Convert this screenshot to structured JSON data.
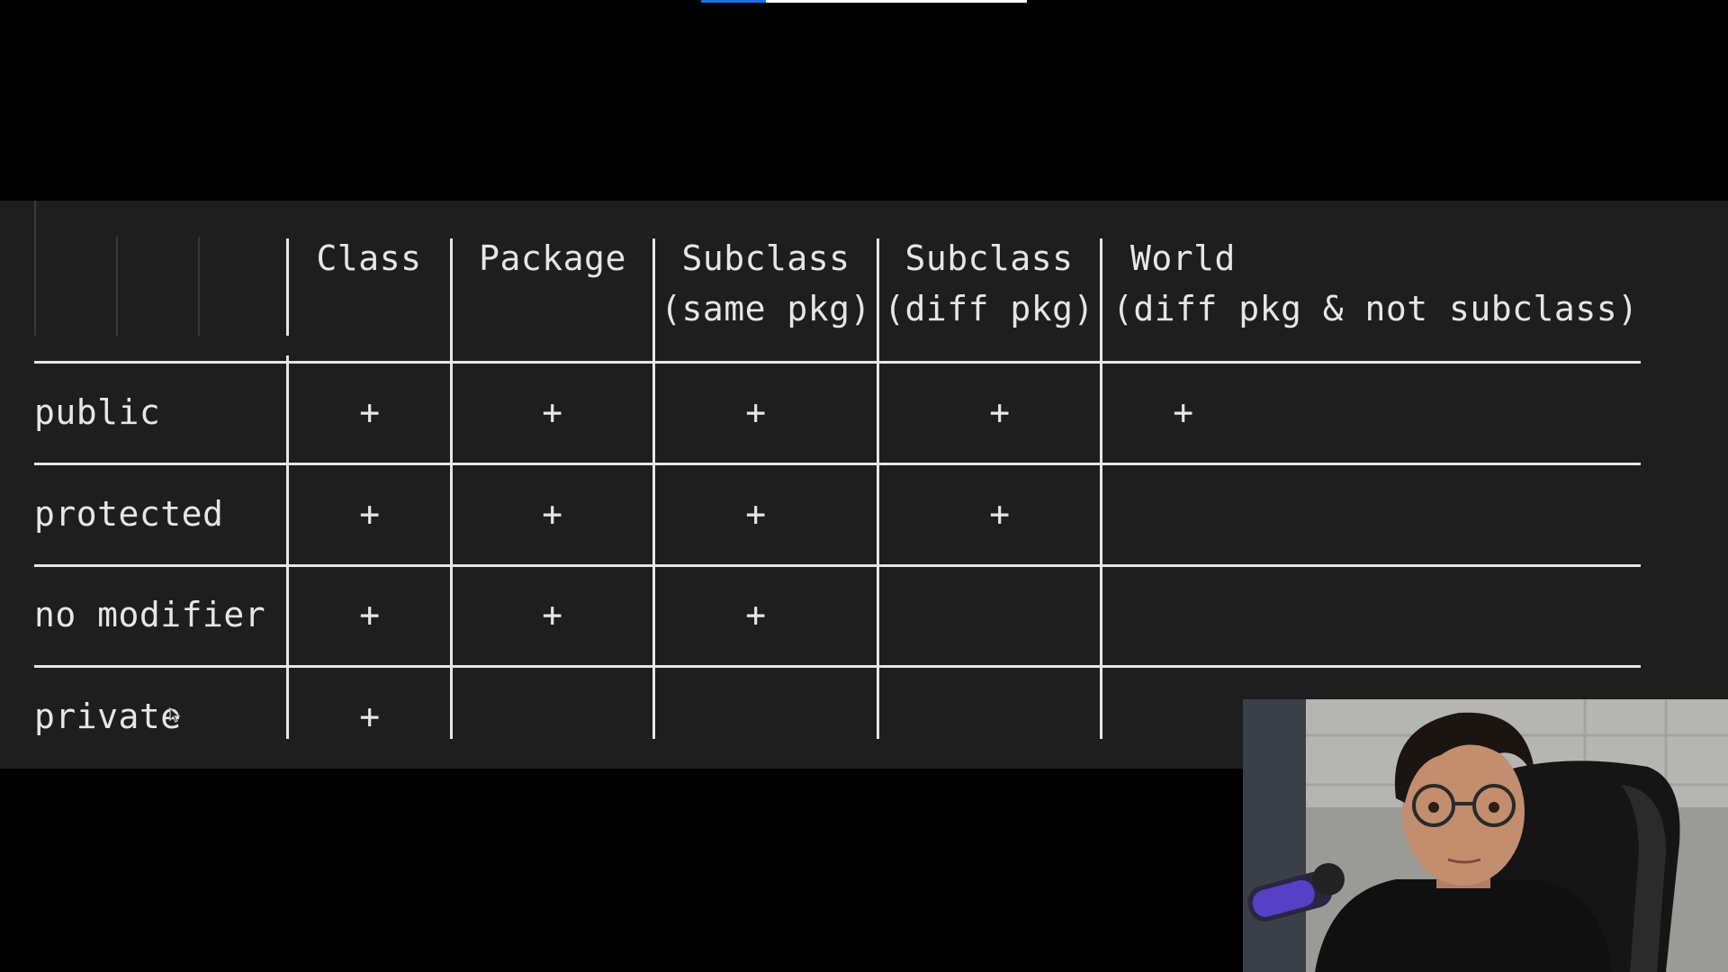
{
  "video": {
    "progress_percent": 20
  },
  "table": {
    "headers": [
      {
        "line1": "Class",
        "line2": ""
      },
      {
        "line1": "Package",
        "line2": ""
      },
      {
        "line1": "Subclass",
        "line2": "(same pkg)"
      },
      {
        "line1": "Subclass",
        "line2": "(diff pkg)"
      },
      {
        "line1": "World",
        "line2": "(diff pkg & not subclass)"
      }
    ],
    "rows": [
      {
        "label": "public",
        "cells": [
          "+",
          "+",
          "+",
          "+",
          "+"
        ]
      },
      {
        "label": "protected",
        "cells": [
          "+",
          "+",
          "+",
          "+",
          ""
        ]
      },
      {
        "label": "no modifier",
        "cells": [
          "+",
          "+",
          "+",
          "",
          ""
        ]
      },
      {
        "label": "private",
        "cells": [
          "+",
          "",
          "",
          "",
          ""
        ]
      }
    ]
  },
  "webcam": {
    "description_icon": "presenter-webcam"
  }
}
